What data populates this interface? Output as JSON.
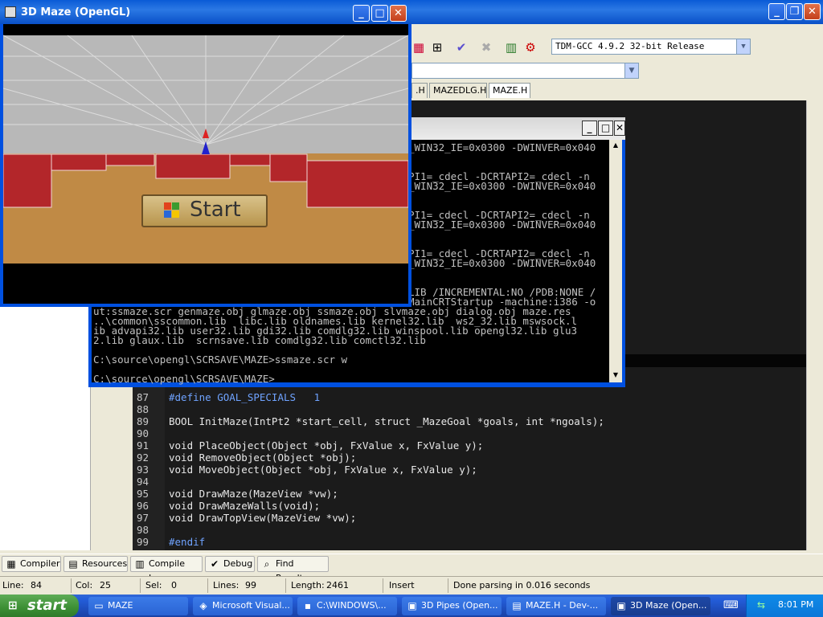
{
  "maze_window": {
    "title": "3D Maze (OpenGL)",
    "start_button_label": "Start"
  },
  "ide": {
    "compiler": "TDM-GCC 4.9.2 32-bit Release",
    "editor_tabs": [
      ".H",
      "MAZEDLG.H",
      "MAZE.H"
    ],
    "code_lines": [
      {
        "n": "87",
        "text": "#define GOAL_SPECIALS   1"
      },
      {
        "n": "88",
        "text": ""
      },
      {
        "n": "89",
        "text": "BOOL InitMaze(IntPt2 *start_cell, struct _MazeGoal *goals, int *ngoals);"
      },
      {
        "n": "90",
        "text": ""
      },
      {
        "n": "91",
        "text": "void PlaceObject(Object *obj, FxValue x, FxValue y);"
      },
      {
        "n": "92",
        "text": "void RemoveObject(Object *obj);"
      },
      {
        "n": "93",
        "text": "void MoveObject(Object *obj, FxValue x, FxValue y);"
      },
      {
        "n": "94",
        "text": ""
      },
      {
        "n": "95",
        "text": "void DrawMaze(MazeView *vw);"
      },
      {
        "n": "96",
        "text": "void DrawMazeWalls(void);"
      },
      {
        "n": "97",
        "text": "void DrawTopView(MazeView *vw);"
      },
      {
        "n": "98",
        "text": ""
      },
      {
        "n": "99",
        "text": "#endif"
      }
    ],
    "bottom_tabs": [
      "Compiler",
      "Resources",
      "Compile Log",
      "Debug",
      "Find Results"
    ],
    "status": {
      "line_label": "Line:",
      "line_value": "84",
      "col_label": "Col:",
      "col_value": "25",
      "sel_label": "Sel:",
      "sel_value": "0",
      "lines_label": "Lines:",
      "lines_value": "99",
      "length_label": "Length:",
      "length_value": "2461",
      "mode": "Insert",
      "message": "Done parsing in 0.016 seconds"
    }
  },
  "cmd_window": {
    "lines": [
      "_WIN32_IE=0x0300 -DWINVER=0x040",
      "",
      "",
      "PI1=_cdecl -DCRTAPI2=_cdecl -n",
      "_WIN32_IE=0x0300 -DWINVER=0x040",
      "",
      "",
      "PI1=_cdecl -DCRTAPI2=_cdecl -n",
      "_WIN32_IE=0x0300 -DWINVER=0x040",
      "",
      "",
      "PI1=_cdecl -DCRTAPI2=_cdecl -n",
      "_WIN32_IE=0x0300 -DWINVER=0x040",
      "",
      "",
      "LIB /INCREMENTAL:NO /PDB:NONE /",
      "MainCRTStartup -machine:i386 -o",
      "ut:ssmaze.scr genmaze.obj glmaze.obj ssmaze.obj slvmaze.obj dialog.obj maze.res",
      "..\\common\\sscommon.lib  libc.lib oldnames.lib kernel32.lib  ws2_32.lib mswsock.l",
      "ib advapi32.lib user32.lib gdi32.lib comdlg32.lib winspool.lib opengl32.lib glu3",
      "2.lib glaux.lib  scrnsave.lib comdlg32.lib comctl32.lib",
      "",
      "C:\\source\\opengl\\SCRSAVE\\MAZE>ssmaze.scr w",
      "",
      "C:\\source\\opengl\\SCRSAVE\\MAZE>"
    ]
  },
  "taskbar": {
    "start_label": "start",
    "tasks": [
      "MAZE",
      "Microsoft Visual...",
      "C:\\WINDOWS\\...",
      "3D Pipes (Open...",
      "MAZE.H - Dev-...",
      "3D Maze (Open..."
    ],
    "clock": "8:01 PM"
  }
}
